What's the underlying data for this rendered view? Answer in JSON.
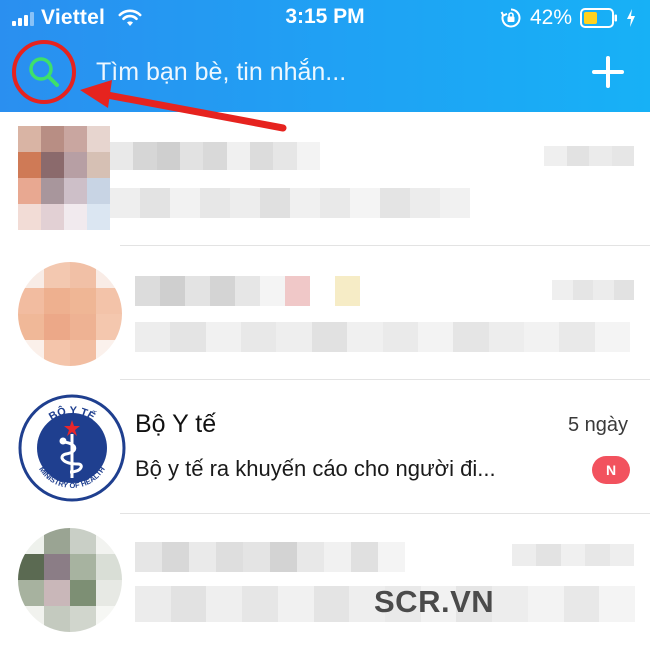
{
  "status_bar": {
    "carrier": "Viettel",
    "time": "3:15 PM",
    "battery_percent": "42%",
    "icons": [
      "signal-icon",
      "wifi-icon",
      "orientation-lock-icon",
      "battery-icon",
      "charging-icon"
    ]
  },
  "search": {
    "placeholder": "Tìm bạn bè, tin nhắn...",
    "icon": "search-icon",
    "add_icon": "plus-icon"
  },
  "colors": {
    "header_gradient_start": "#2a8ff0",
    "header_gradient_end": "#17b1f6",
    "highlight_red": "#e6231f",
    "badge_red": "#f2525e"
  },
  "conversations": [
    {
      "name": "",
      "time": "",
      "preview": "",
      "blurred": true
    },
    {
      "name": "",
      "time": "",
      "preview": "",
      "blurred": true
    },
    {
      "name": "Bộ Y tế",
      "time": "5 ngày",
      "preview": "Bộ y tế ra khuyến cáo cho người đi...",
      "badge": "N",
      "avatar": {
        "top_text": "BỘ Y TẾ",
        "bottom_text": "MINISTRY OF HEALTH"
      }
    },
    {
      "name": "",
      "time": "",
      "preview": "",
      "blurred": true
    }
  ],
  "watermark": "SCR.VN"
}
